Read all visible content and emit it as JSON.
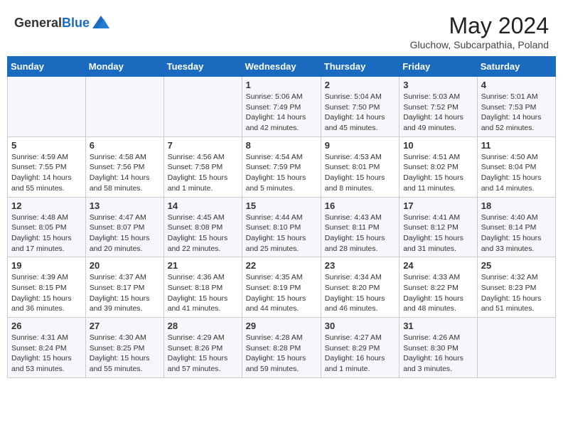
{
  "header": {
    "logo_general": "General",
    "logo_blue": "Blue",
    "month_title": "May 2024",
    "subtitle": "Gluchow, Subcarpathia, Poland"
  },
  "weekdays": [
    "Sunday",
    "Monday",
    "Tuesday",
    "Wednesday",
    "Thursday",
    "Friday",
    "Saturday"
  ],
  "weeks": [
    [
      {
        "day": "",
        "sunrise": "",
        "sunset": "",
        "daylight": ""
      },
      {
        "day": "",
        "sunrise": "",
        "sunset": "",
        "daylight": ""
      },
      {
        "day": "",
        "sunrise": "",
        "sunset": "",
        "daylight": ""
      },
      {
        "day": "1",
        "sunrise": "Sunrise: 5:06 AM",
        "sunset": "Sunset: 7:49 PM",
        "daylight": "Daylight: 14 hours and 42 minutes."
      },
      {
        "day": "2",
        "sunrise": "Sunrise: 5:04 AM",
        "sunset": "Sunset: 7:50 PM",
        "daylight": "Daylight: 14 hours and 45 minutes."
      },
      {
        "day": "3",
        "sunrise": "Sunrise: 5:03 AM",
        "sunset": "Sunset: 7:52 PM",
        "daylight": "Daylight: 14 hours and 49 minutes."
      },
      {
        "day": "4",
        "sunrise": "Sunrise: 5:01 AM",
        "sunset": "Sunset: 7:53 PM",
        "daylight": "Daylight: 14 hours and 52 minutes."
      }
    ],
    [
      {
        "day": "5",
        "sunrise": "Sunrise: 4:59 AM",
        "sunset": "Sunset: 7:55 PM",
        "daylight": "Daylight: 14 hours and 55 minutes."
      },
      {
        "day": "6",
        "sunrise": "Sunrise: 4:58 AM",
        "sunset": "Sunset: 7:56 PM",
        "daylight": "Daylight: 14 hours and 58 minutes."
      },
      {
        "day": "7",
        "sunrise": "Sunrise: 4:56 AM",
        "sunset": "Sunset: 7:58 PM",
        "daylight": "Daylight: 15 hours and 1 minute."
      },
      {
        "day": "8",
        "sunrise": "Sunrise: 4:54 AM",
        "sunset": "Sunset: 7:59 PM",
        "daylight": "Daylight: 15 hours and 5 minutes."
      },
      {
        "day": "9",
        "sunrise": "Sunrise: 4:53 AM",
        "sunset": "Sunset: 8:01 PM",
        "daylight": "Daylight: 15 hours and 8 minutes."
      },
      {
        "day": "10",
        "sunrise": "Sunrise: 4:51 AM",
        "sunset": "Sunset: 8:02 PM",
        "daylight": "Daylight: 15 hours and 11 minutes."
      },
      {
        "day": "11",
        "sunrise": "Sunrise: 4:50 AM",
        "sunset": "Sunset: 8:04 PM",
        "daylight": "Daylight: 15 hours and 14 minutes."
      }
    ],
    [
      {
        "day": "12",
        "sunrise": "Sunrise: 4:48 AM",
        "sunset": "Sunset: 8:05 PM",
        "daylight": "Daylight: 15 hours and 17 minutes."
      },
      {
        "day": "13",
        "sunrise": "Sunrise: 4:47 AM",
        "sunset": "Sunset: 8:07 PM",
        "daylight": "Daylight: 15 hours and 20 minutes."
      },
      {
        "day": "14",
        "sunrise": "Sunrise: 4:45 AM",
        "sunset": "Sunset: 8:08 PM",
        "daylight": "Daylight: 15 hours and 22 minutes."
      },
      {
        "day": "15",
        "sunrise": "Sunrise: 4:44 AM",
        "sunset": "Sunset: 8:10 PM",
        "daylight": "Daylight: 15 hours and 25 minutes."
      },
      {
        "day": "16",
        "sunrise": "Sunrise: 4:43 AM",
        "sunset": "Sunset: 8:11 PM",
        "daylight": "Daylight: 15 hours and 28 minutes."
      },
      {
        "day": "17",
        "sunrise": "Sunrise: 4:41 AM",
        "sunset": "Sunset: 8:12 PM",
        "daylight": "Daylight: 15 hours and 31 minutes."
      },
      {
        "day": "18",
        "sunrise": "Sunrise: 4:40 AM",
        "sunset": "Sunset: 8:14 PM",
        "daylight": "Daylight: 15 hours and 33 minutes."
      }
    ],
    [
      {
        "day": "19",
        "sunrise": "Sunrise: 4:39 AM",
        "sunset": "Sunset: 8:15 PM",
        "daylight": "Daylight: 15 hours and 36 minutes."
      },
      {
        "day": "20",
        "sunrise": "Sunrise: 4:37 AM",
        "sunset": "Sunset: 8:17 PM",
        "daylight": "Daylight: 15 hours and 39 minutes."
      },
      {
        "day": "21",
        "sunrise": "Sunrise: 4:36 AM",
        "sunset": "Sunset: 8:18 PM",
        "daylight": "Daylight: 15 hours and 41 minutes."
      },
      {
        "day": "22",
        "sunrise": "Sunrise: 4:35 AM",
        "sunset": "Sunset: 8:19 PM",
        "daylight": "Daylight: 15 hours and 44 minutes."
      },
      {
        "day": "23",
        "sunrise": "Sunrise: 4:34 AM",
        "sunset": "Sunset: 8:20 PM",
        "daylight": "Daylight: 15 hours and 46 minutes."
      },
      {
        "day": "24",
        "sunrise": "Sunrise: 4:33 AM",
        "sunset": "Sunset: 8:22 PM",
        "daylight": "Daylight: 15 hours and 48 minutes."
      },
      {
        "day": "25",
        "sunrise": "Sunrise: 4:32 AM",
        "sunset": "Sunset: 8:23 PM",
        "daylight": "Daylight: 15 hours and 51 minutes."
      }
    ],
    [
      {
        "day": "26",
        "sunrise": "Sunrise: 4:31 AM",
        "sunset": "Sunset: 8:24 PM",
        "daylight": "Daylight: 15 hours and 53 minutes."
      },
      {
        "day": "27",
        "sunrise": "Sunrise: 4:30 AM",
        "sunset": "Sunset: 8:25 PM",
        "daylight": "Daylight: 15 hours and 55 minutes."
      },
      {
        "day": "28",
        "sunrise": "Sunrise: 4:29 AM",
        "sunset": "Sunset: 8:26 PM",
        "daylight": "Daylight: 15 hours and 57 minutes."
      },
      {
        "day": "29",
        "sunrise": "Sunrise: 4:28 AM",
        "sunset": "Sunset: 8:28 PM",
        "daylight": "Daylight: 15 hours and 59 minutes."
      },
      {
        "day": "30",
        "sunrise": "Sunrise: 4:27 AM",
        "sunset": "Sunset: 8:29 PM",
        "daylight": "Daylight: 16 hours and 1 minute."
      },
      {
        "day": "31",
        "sunrise": "Sunrise: 4:26 AM",
        "sunset": "Sunset: 8:30 PM",
        "daylight": "Daylight: 16 hours and 3 minutes."
      },
      {
        "day": "",
        "sunrise": "",
        "sunset": "",
        "daylight": ""
      }
    ]
  ]
}
